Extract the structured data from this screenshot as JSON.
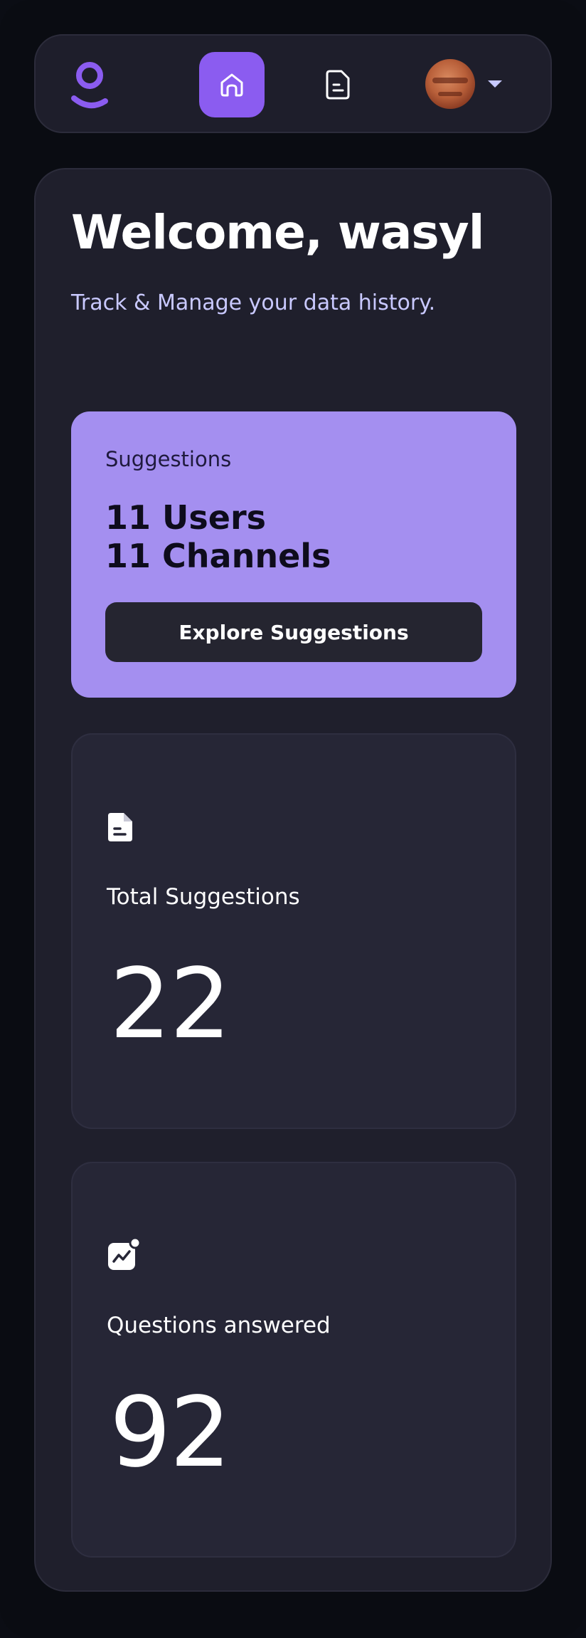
{
  "header": {
    "logo_icon": "user-logo-icon",
    "nav": [
      {
        "id": "home",
        "icon": "home-icon",
        "active": true
      },
      {
        "id": "documents",
        "icon": "document-icon",
        "active": false
      }
    ],
    "profile": {
      "avatar": "avatar",
      "menu_icon": "chevron-down-icon"
    }
  },
  "main": {
    "title": "Welcome, wasyl",
    "subtitle": "Track & Manage your data history."
  },
  "suggestions": {
    "label": "Suggestions",
    "users": "11 Users",
    "channels": "11 Channels",
    "button": "Explore Suggestions"
  },
  "stats": [
    {
      "label": "Total Suggestions",
      "value": "22",
      "icon": "document-icon"
    },
    {
      "label": "Questions answered",
      "value": "92",
      "icon": "chart-icon"
    }
  ],
  "colors": {
    "accent": "#8b5cf0",
    "card_purple": "#a48ff0",
    "background": "#0a0c12",
    "panel": "#1f1f2c"
  }
}
